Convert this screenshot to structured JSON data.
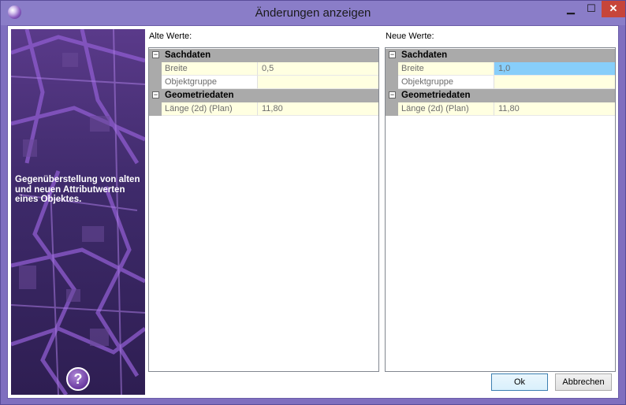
{
  "window": {
    "title": "Änderungen anzeigen",
    "minimize_glyph": "▁",
    "maximize_glyph": "☐",
    "close_glyph": "✕"
  },
  "side": {
    "description": "Gegenüberstellung von alten und neuen Attributwerten eines Objektes.",
    "help_glyph": "?"
  },
  "old": {
    "label": "Alte Werte:",
    "categories": [
      {
        "title": "Sachdaten",
        "toggle": "−",
        "rows": [
          {
            "name": "Breite",
            "value": "0,5"
          },
          {
            "name": "Objektgruppe",
            "value": ""
          }
        ]
      },
      {
        "title": "Geometriedaten",
        "toggle": "−",
        "rows": [
          {
            "name": "Länge (2d) (Plan)",
            "value": "11,80"
          }
        ]
      }
    ]
  },
  "new": {
    "label": "Neue Werte:",
    "categories": [
      {
        "title": "Sachdaten",
        "toggle": "−",
        "rows": [
          {
            "name": "Breite",
            "value": "1,0"
          },
          {
            "name": "Objektgruppe",
            "value": ""
          }
        ]
      },
      {
        "title": "Geometriedaten",
        "toggle": "−",
        "rows": [
          {
            "name": "Länge (2d) (Plan)",
            "value": "11,80"
          }
        ]
      }
    ]
  },
  "buttons": {
    "ok": "Ok",
    "cancel": "Abbrechen"
  },
  "colors": {
    "titlebar": "#8a7dc8",
    "changed_value": "#87cefa",
    "value_background": "#ffffe1",
    "category_background": "#aaaaaa"
  }
}
